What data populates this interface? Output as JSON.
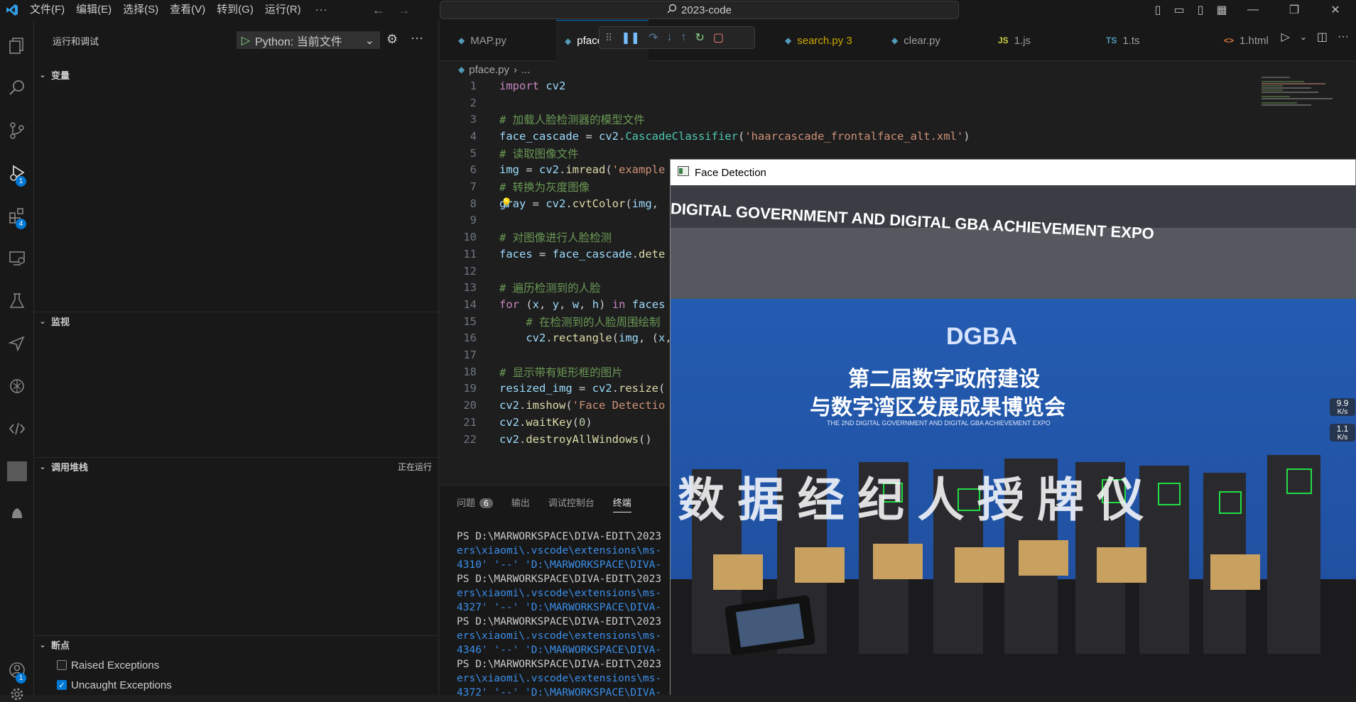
{
  "titlebar": {
    "menu": [
      "文件(F)",
      "编辑(E)",
      "选择(S)",
      "查看(V)",
      "转到(G)",
      "运行(R)"
    ],
    "more": "···",
    "search_text": "2023-code"
  },
  "activity": {
    "run_badge": "1",
    "extensions_badge": "4",
    "accounts_badge": "1"
  },
  "sidebar": {
    "title": "运行和调试",
    "launch_config": "Python: 当前文件",
    "sections": {
      "variables": "变量",
      "watch": "监视",
      "callstack": "调用堆栈",
      "callstack_status": "正在运行",
      "breakpoints": "断点"
    },
    "breakpoints": [
      {
        "label": "Raised Exceptions",
        "checked": false
      },
      {
        "label": "Uncaught Exceptions",
        "checked": true
      }
    ]
  },
  "tabs": [
    {
      "label": "MAP.py",
      "icon": "python-file-icon",
      "active": false
    },
    {
      "label": "pface.py",
      "icon": "python-file-icon",
      "active": true
    },
    {
      "label": "search.py 3",
      "icon": "python-file-icon",
      "active": false,
      "warning": true
    },
    {
      "label": "clear.py",
      "icon": "python-file-icon",
      "active": false
    },
    {
      "label": "1.js",
      "icon": "js-file-icon",
      "active": false
    },
    {
      "label": "1.ts",
      "icon": "ts-file-icon",
      "active": false
    },
    {
      "label": "1.html",
      "icon": "html-file-icon",
      "active": false
    }
  ],
  "breadcrumb": {
    "file": "pface.py",
    "rest": "..."
  },
  "code_lines": [
    "import cv2",
    "",
    "# 加载人脸检测器的模型文件",
    "face_cascade = cv2.CascadeClassifier('haarcascade_frontalface_alt.xml')",
    "# 读取图像文件",
    "img = cv2.imread('example",
    "# 转换为灰度图像",
    "gray = cv2.cvtColor(img,",
    "",
    "# 对图像进行人脸检测",
    "faces = face_cascade.dete",
    "",
    "# 遍历检测到的人脸",
    "for (x, y, w, h) in faces",
    "    # 在检测到的人脸周围绘制",
    "    cv2.rectangle(img, (x,",
    "",
    "# 显示带有矩形框的图片",
    "resized_img = cv2.resize(",
    "cv2.imshow('Face Detectio",
    "cv2.waitKey(0)",
    "cv2.destroyAllWindows()"
  ],
  "panel": {
    "tabs": [
      "问题",
      "输出",
      "调试控制台",
      "终端"
    ],
    "problems_count": "6",
    "active_tab": "终端",
    "terminal_lines": [
      {
        "text": "PS D:\\MARWORKSPACE\\DIVA-EDIT\\2023",
        "cls": "t-ps"
      },
      {
        "text": "ers\\xiaomi\\.vscode\\extensions\\ms-",
        "cls": "t-blue"
      },
      {
        "text": "4310' '--' 'D:\\MARWORKSPACE\\DIVA-",
        "cls": "t-blue"
      },
      {
        "text": "PS D:\\MARWORKSPACE\\DIVA-EDIT\\2023",
        "cls": "t-ps"
      },
      {
        "text": "ers\\xiaomi\\.vscode\\extensions\\ms-",
        "cls": "t-blue"
      },
      {
        "text": "4327' '--' 'D:\\MARWORKSPACE\\DIVA-",
        "cls": "t-blue"
      },
      {
        "text": "PS D:\\MARWORKSPACE\\DIVA-EDIT\\2023",
        "cls": "t-ps"
      },
      {
        "text": "ers\\xiaomi\\.vscode\\extensions\\ms-",
        "cls": "t-blue"
      },
      {
        "text": "4346' '--' 'D:\\MARWORKSPACE\\DIVA-",
        "cls": "t-blue"
      },
      {
        "text": "PS D:\\MARWORKSPACE\\DIVA-EDIT\\2023",
        "cls": "t-ps"
      },
      {
        "text": "ers\\xiaomi\\.vscode\\extensions\\ms-",
        "cls": "t-blue"
      },
      {
        "text": "4372' '--' 'D:\\MARWORKSPACE\\DIVA-",
        "cls": "t-blue"
      }
    ]
  },
  "face_window": {
    "title": "Face Detection",
    "banner_top": "DIGITAL GOVERNMENT AND DIGITAL GBA ACHIEVEMENT EXPO",
    "logo_text": "DGBA",
    "headline_1": "第二届数字政府建设",
    "headline_2": "与数字湾区发展成果博览会",
    "subline": "THE 2ND DIGITAL GOVERNMENT AND DIGITAL GBA ACHIEVEMENT EXPO",
    "big_text": "数 据 经 纪 人 授 牌 仪",
    "net_up": "9.9",
    "net_up_unit": "K/s",
    "net_down": "1.1",
    "net_down_unit": "K/s"
  },
  "colors": {
    "accent": "#0078d4",
    "bg": "#1e1e1e",
    "sidebar": "#181818"
  }
}
